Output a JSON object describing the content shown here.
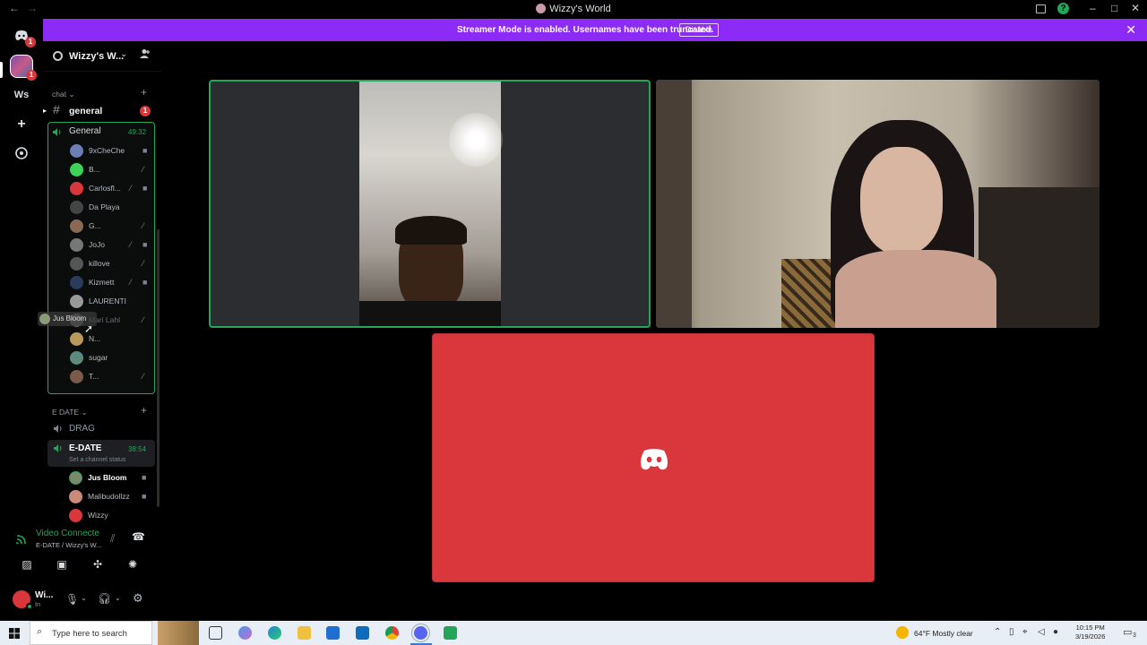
{
  "window": {
    "title": "Wizzy's World",
    "back_icon": "arrow-left",
    "forward_icon": "arrow-right",
    "minimize": "–",
    "maximize": "□",
    "close": "✕"
  },
  "server_rail": {
    "dm_badge": "1",
    "server_badge": "1",
    "server_label": "Ws",
    "add_label": "+",
    "discover_icon": "compass"
  },
  "banner": {
    "text": "Streamer Mode is enabled. Usernames have been truncated.",
    "button": "Disable",
    "close": "✕",
    "color": "#8c2bf5"
  },
  "server": {
    "name": "Wizzy's W...",
    "invite_icon": "add-person"
  },
  "categories": {
    "chat": "chat",
    "edate": "E DATE"
  },
  "text_channel": {
    "name": "general",
    "badge": "1"
  },
  "voice_general": {
    "name": "General",
    "time": "49:32",
    "members": [
      {
        "name": "9xCheChe"
      },
      {
        "name": "B..."
      },
      {
        "name": "Carlosfl..."
      },
      {
        "name": "Da Playa"
      },
      {
        "name": "G..."
      },
      {
        "name": "JoJo"
      },
      {
        "name": "killove"
      },
      {
        "name": "Kizmett"
      },
      {
        "name": "LAURENTI"
      },
      {
        "name": "Mari Lahl"
      },
      {
        "name": "N..."
      },
      {
        "name": "sugar"
      },
      {
        "name": "T..."
      }
    ],
    "dragging_name": "Jus Bloom"
  },
  "voice_drag": {
    "name": "DRAG"
  },
  "voice_edate": {
    "name": "E-DATE",
    "time": "38:54",
    "status_hint": "Set a channel status",
    "members": [
      {
        "name": "Jus Bloom"
      },
      {
        "name": "Malibudollzz"
      },
      {
        "name": "Wizzy"
      }
    ]
  },
  "voice_panel": {
    "status": "Video Connecte",
    "location": "E-DATE / Wizzy's W..."
  },
  "user_panel": {
    "name": "Wi...",
    "status": "In"
  },
  "taskbar": {
    "search_placeholder": "Type here to search",
    "weather": "64°F  Mostly clear",
    "time": "10:15 PM",
    "date": "3/19/2026",
    "notif_count": "3"
  },
  "colors": {
    "speaking_green": "#23a55a",
    "discord_red": "#da373c",
    "badge_red": "#da373c"
  }
}
